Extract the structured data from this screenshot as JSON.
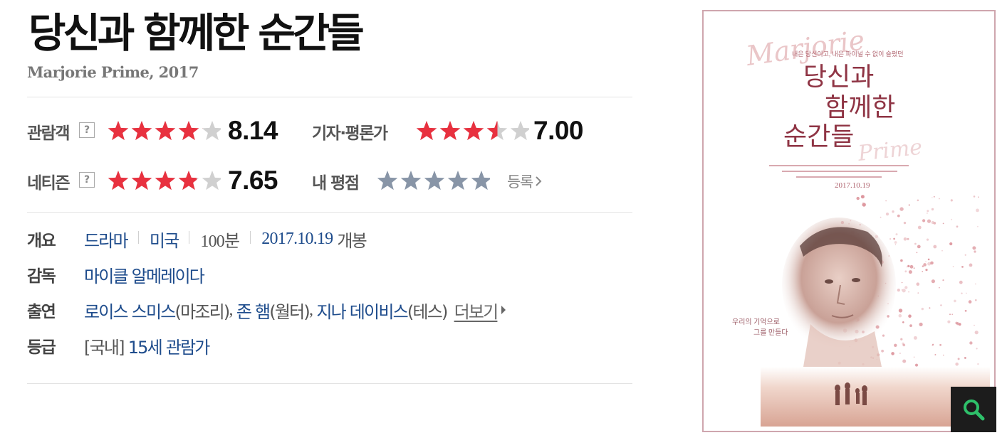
{
  "movie": {
    "title": "당신과 함께한 순간들",
    "original": "Marjorie Prime, 2017"
  },
  "ratings": {
    "audience": {
      "label": "관람객",
      "help": "?",
      "score": "8.14",
      "stars_fill": 0.814
    },
    "critic": {
      "label": "기자·평론가",
      "score": "7.00",
      "stars_fill": 0.7
    },
    "netizen": {
      "label": "네티즌",
      "help": "?",
      "score": "7.65",
      "stars_fill": 0.765
    },
    "mine": {
      "label": "내 평점",
      "register": "등록"
    }
  },
  "info": {
    "overview_label": "개요",
    "genre": "드라마",
    "country": "미국",
    "runtime": "100분",
    "release_date": "2017.10.19",
    "release_suffix": "개봉",
    "director_label": "감독",
    "director": "마이클 알메레이다",
    "cast_label": "출연",
    "cast": [
      {
        "name": "로이스 스미스",
        "role": "(마조리)",
        "comma": ", "
      },
      {
        "name": "존 햄",
        "role": "(월터)",
        "comma": ", "
      },
      {
        "name": "지나 데이비스",
        "role": "(테스)",
        "comma": ""
      }
    ],
    "more": "더보기",
    "grade_label": "등급",
    "grade_prefix": "[국내]",
    "grade": "15세 관람가"
  },
  "poster": {
    "script_title": "Marjorie",
    "script_title2": "Prime",
    "tagline": "내은 당신이고, 내은 파이널 수 없이 슬펐던",
    "title_line1": "당신과",
    "title_line2": "함께한",
    "title_line3": "순간들",
    "date": "2017.10.19",
    "quote_line1": "우리의 기억으로",
    "quote_line2": "그를 만들다"
  },
  "colors": {
    "star_red": "#e8313f",
    "star_empty": "#d0d0d0",
    "star_mine": "#8895a7",
    "link": "#1e4c8c"
  }
}
